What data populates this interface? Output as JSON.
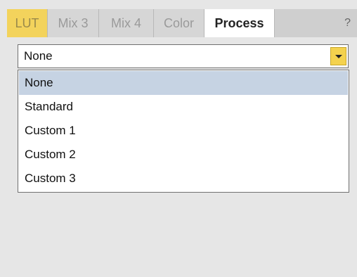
{
  "tabs": [
    {
      "label": "LUT"
    },
    {
      "label": "Mix 3"
    },
    {
      "label": "Mix 4"
    },
    {
      "label": "Color"
    },
    {
      "label": "Process"
    }
  ],
  "help_label": "?",
  "dropdown": {
    "value": "None",
    "options": [
      "None",
      "Standard",
      "Custom 1",
      "Custom 2",
      "Custom 3"
    ]
  },
  "colors": {
    "active_tab_accent": "#f3d35c",
    "dropdown_button": "#f4d24e",
    "selected_option": "#c6d3e3",
    "panel_background": "#e6e6e6"
  }
}
